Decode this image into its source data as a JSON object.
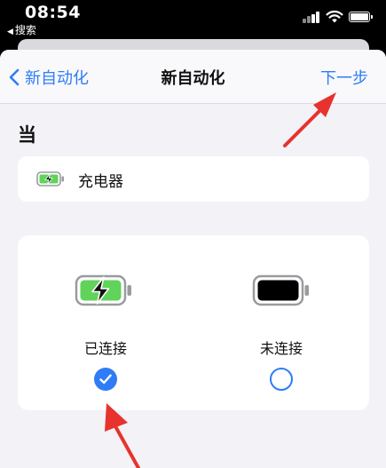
{
  "status_bar": {
    "time": "08:54",
    "back_app_label": "搜索",
    "back_arrow_glyph": "◀"
  },
  "nav": {
    "back_label": "新自动化",
    "title": "新自动化",
    "next_label": "下一步"
  },
  "section_title": "当",
  "trigger": {
    "label": "充电器",
    "icon": "charging-battery-icon"
  },
  "options": [
    {
      "label": "已连接",
      "selected": true,
      "icon": "charging-battery-icon"
    },
    {
      "label": "未连接",
      "selected": false,
      "icon": "full-battery-icon"
    }
  ],
  "colors": {
    "accent": "#2f7cf6",
    "battery_green": "#5fd35a",
    "annotation_red": "#e8322d",
    "background": "#f2f2f7"
  }
}
